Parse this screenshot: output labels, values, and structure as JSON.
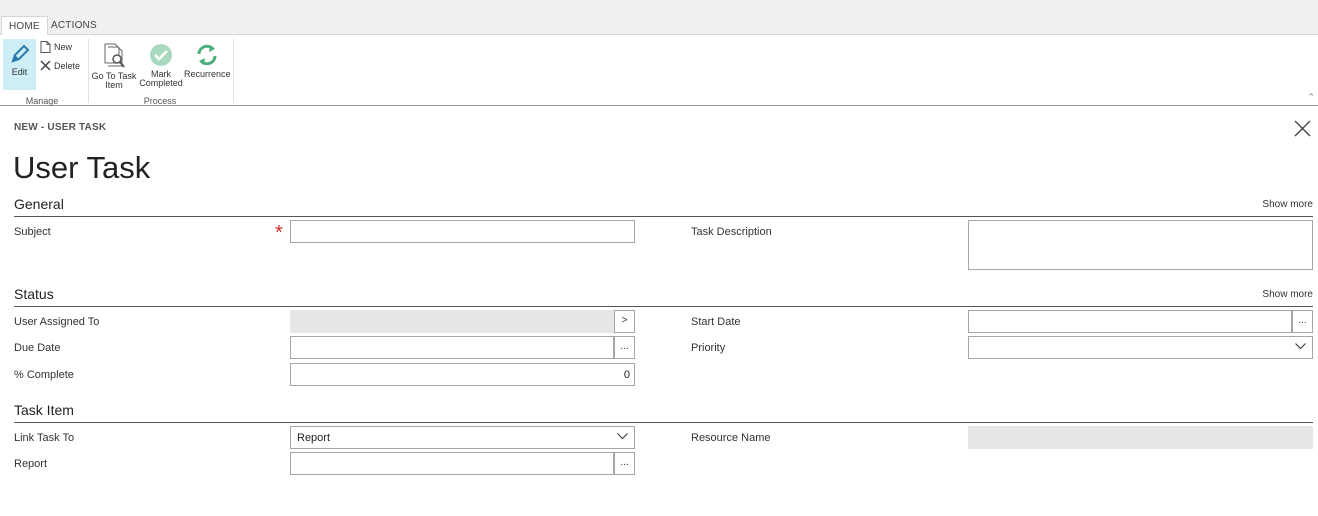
{
  "ribbon": {
    "tabs": [
      {
        "label": "HOME"
      },
      {
        "label": "ACTIONS"
      }
    ],
    "manage": {
      "label": "Manage",
      "edit": "Edit",
      "new": "New",
      "delete": "Delete"
    },
    "process": {
      "label": "Process",
      "goto_line1": "Go To Task",
      "goto_line2": "Item",
      "mark_line1": "Mark",
      "mark_line2": "Completed",
      "recurrence": "Recurrence"
    }
  },
  "page": {
    "breadcrumb": "NEW - USER TASK",
    "title": "User Task",
    "required_marker": "*"
  },
  "general": {
    "title": "General",
    "show_more": "Show more",
    "subject_label": "Subject",
    "subject_value": "",
    "task_description_label": "Task Description",
    "task_description_value": ""
  },
  "status": {
    "title": "Status",
    "show_more": "Show more",
    "user_assigned_label": "User Assigned To",
    "user_assigned_button": ">",
    "due_date_label": "Due Date",
    "due_date_button": "...",
    "percent_complete_label": "% Complete",
    "percent_complete_value": "0",
    "start_date_label": "Start Date",
    "start_date_button": "...",
    "priority_label": "Priority",
    "priority_value": ""
  },
  "task_item": {
    "title": "Task Item",
    "link_task_to_label": "Link Task To",
    "link_task_to_value": "Report",
    "report_label": "Report",
    "report_button": "...",
    "resource_name_label": "Resource Name"
  },
  "colors": {
    "selected_button_bg": "#cdeef5",
    "required": "#d62b2b",
    "check_icon": "#7fbf9e",
    "recurrence_icon": "#4caf7d"
  }
}
